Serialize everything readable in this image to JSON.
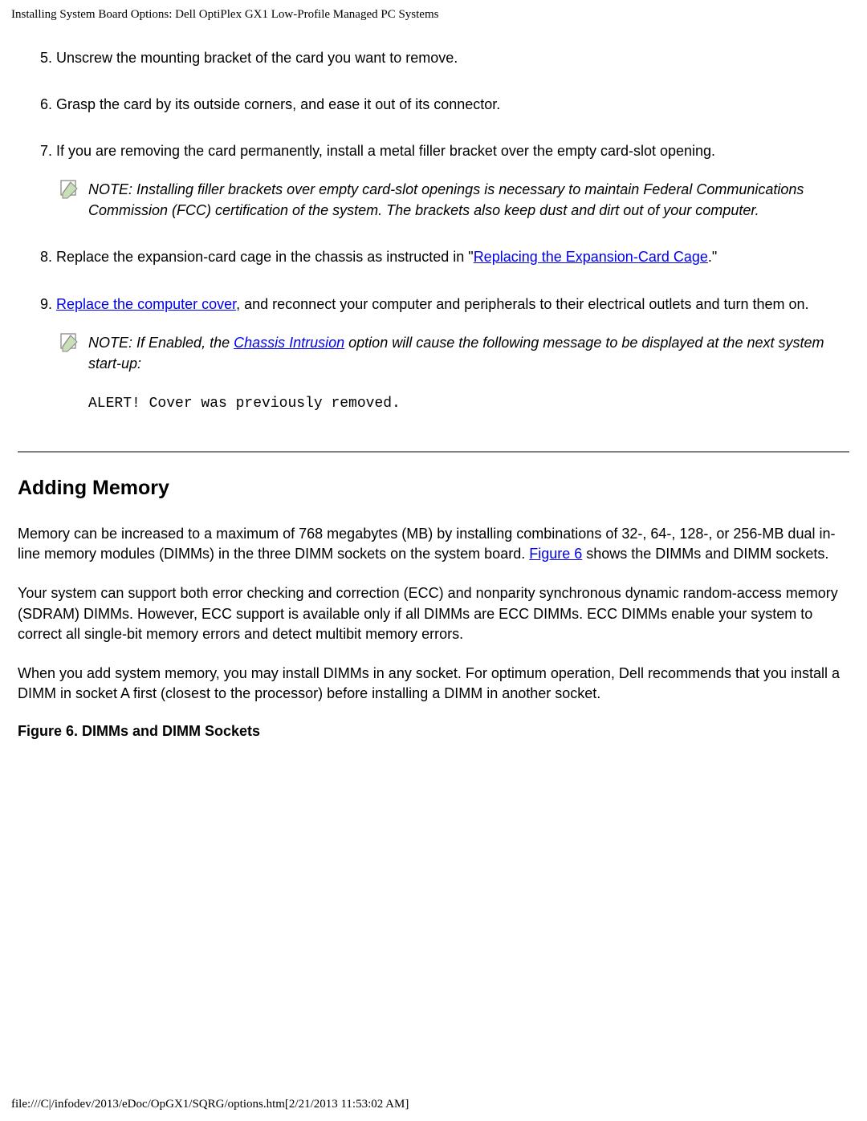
{
  "header": {
    "title": "Installing System Board Options: Dell OptiPlex GX1 Low-Profile Managed PC Systems"
  },
  "steps": {
    "s5": {
      "num": "5.",
      "text": "Unscrew the mounting bracket of the card you want to remove."
    },
    "s6": {
      "num": "6.",
      "text": "Grasp the card by its outside corners, and ease it out of its connector."
    },
    "s7": {
      "num": "7.",
      "text": "If you are removing the card permanently, install a metal filler bracket over the empty card-slot opening.",
      "note": "NOTE: Installing filler brackets over empty card-slot openings is necessary to maintain Federal Communications Commission (FCC) certification of the system. The brackets also keep dust and dirt out of your computer."
    },
    "s8": {
      "num": "8.",
      "text_before_link": "Replace the expansion-card cage in the chassis as instructed in \"",
      "link": "Replacing the Expansion-Card Cage",
      "text_after_link": ".\""
    },
    "s9": {
      "num": "9.",
      "link": "Replace the computer cover",
      "text_after_link": ", and reconnect your computer and peripherals to their electrical outlets and turn them on.",
      "note_before": "NOTE: If Enabled, the ",
      "note_link": "Chassis Intrusion",
      "note_after": " option will cause the following message to be displayed at the next system start-up:",
      "alert": "ALERT! Cover was previously removed."
    }
  },
  "memory": {
    "heading": "Adding Memory",
    "p1_before": "Memory can be increased to a maximum of 768 megabytes (MB) by installing combinations of 32-, 64-, 128-, or 256-MB dual in-line memory modules (DIMMs) in the three DIMM sockets on the system board. ",
    "p1_link": "Figure 6",
    "p1_after": " shows the DIMMs and DIMM sockets.",
    "p2": "Your system can support both error checking and correction (ECC) and nonparity synchronous dynamic random-access memory (SDRAM) DIMMs. However, ECC support is available only if all DIMMs are ECC DIMMs. ECC DIMMs enable your system to correct all single-bit memory errors and detect multibit memory errors.",
    "p3": "When you add system memory, you may install DIMMs in any socket. For optimum operation, Dell recommends that you install a DIMM in socket A first (closest to the processor) before installing a DIMM in another socket.",
    "figure_caption": "Figure 6. DIMMs and DIMM Sockets"
  },
  "footer": {
    "path": "file:///C|/infodev/2013/eDoc/OpGX1/SQRG/options.htm[2/21/2013 11:53:02 AM]"
  }
}
